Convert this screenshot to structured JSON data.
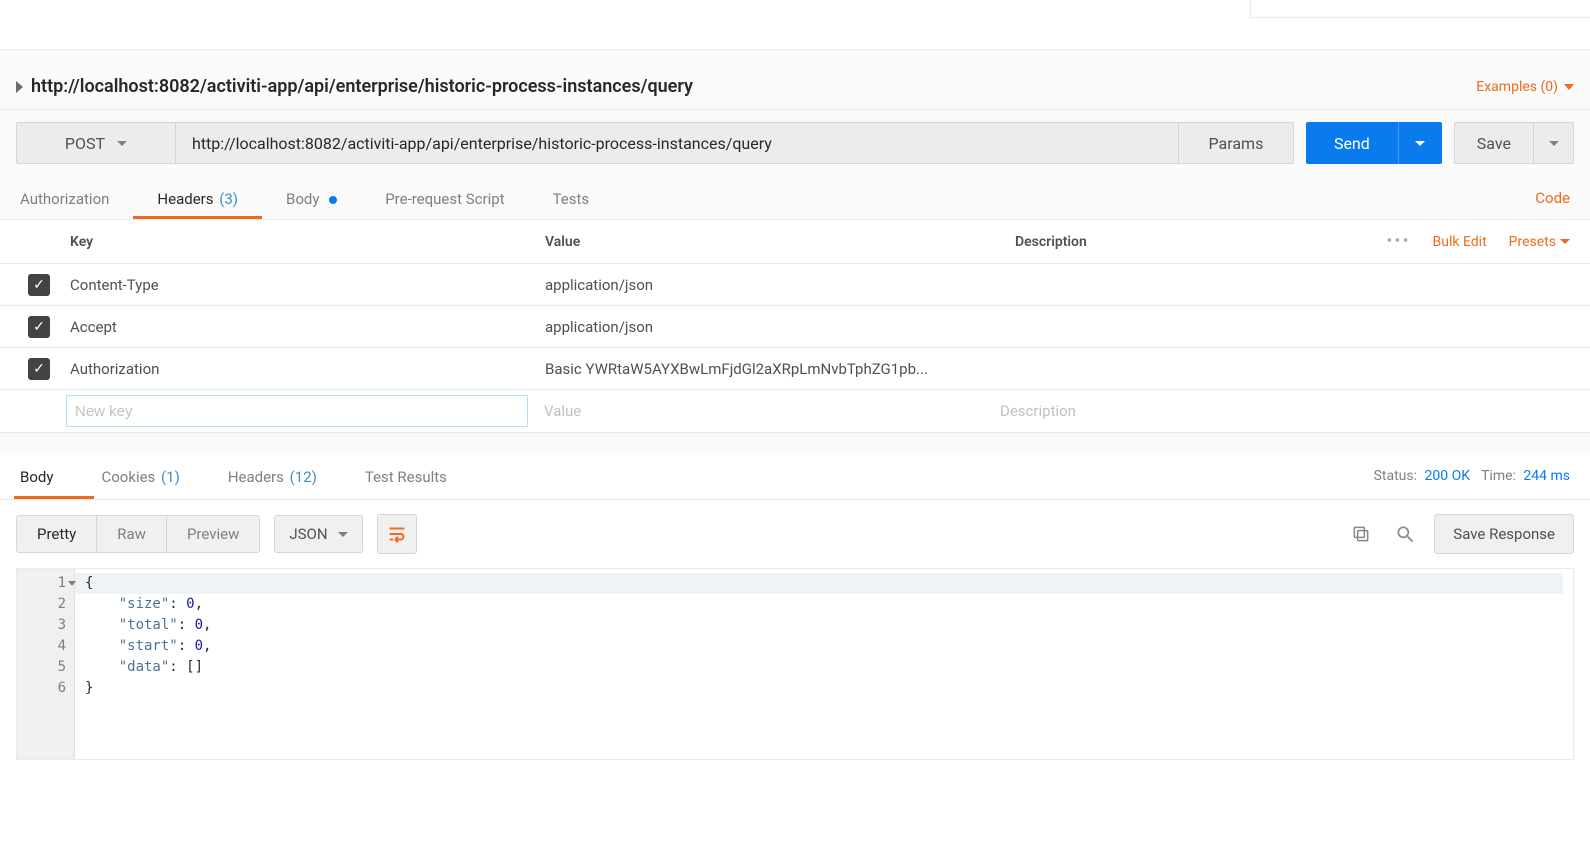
{
  "title": "http://localhost:8082/activiti-app/api/enterprise/historic-process-instances/query",
  "examples": {
    "label": "Examples (0)"
  },
  "request": {
    "method": "POST",
    "url": "http://localhost:8082/activiti-app/api/enterprise/historic-process-instances/query",
    "params_btn": "Params",
    "send_btn": "Send",
    "save_btn": "Save"
  },
  "req_tabs": {
    "authorization": "Authorization",
    "headers": "Headers",
    "headers_count": "(3)",
    "body": "Body",
    "prerequest": "Pre-request Script",
    "tests": "Tests",
    "code": "Code"
  },
  "headers_table": {
    "col_key": "Key",
    "col_value": "Value",
    "col_desc": "Description",
    "bulk_edit": "Bulk Edit",
    "presets": "Presets",
    "rows": [
      {
        "key": "Content-Type",
        "value": "application/json"
      },
      {
        "key": "Accept",
        "value": "application/json"
      },
      {
        "key": "Authorization",
        "value": "Basic YWRtaW5AYXBwLmFjdGl2aXRpLmNvbTphZG1pb..."
      }
    ],
    "new_key_placeholder": "New key",
    "new_value_placeholder": "Value",
    "new_desc_placeholder": "Description"
  },
  "resp_tabs": {
    "body": "Body",
    "cookies": "Cookies",
    "cookies_count": "(1)",
    "headers": "Headers",
    "headers_count": "(12)",
    "test_results": "Test Results"
  },
  "resp_status": {
    "label": "Status:",
    "value": "200 OK"
  },
  "resp_time": {
    "label": "Time:",
    "value": "244 ms"
  },
  "resp_toolbar": {
    "pretty": "Pretty",
    "raw": "Raw",
    "preview": "Preview",
    "lang": "JSON",
    "save_response": "Save Response"
  },
  "code_lines": [
    {
      "n": "1",
      "raw": "{",
      "tokens": [
        {
          "t": "{",
          "c": "json-bracket"
        }
      ]
    },
    {
      "n": "2",
      "raw": "    \"size\": 0,",
      "tokens": [
        {
          "t": "    "
        },
        {
          "t": "\"size\"",
          "c": "json-key"
        },
        {
          "t": ": ",
          "c": "json-punct"
        },
        {
          "t": "0",
          "c": "json-num"
        },
        {
          "t": ",",
          "c": "json-punct"
        }
      ]
    },
    {
      "n": "3",
      "raw": "    \"total\": 0,",
      "tokens": [
        {
          "t": "    "
        },
        {
          "t": "\"total\"",
          "c": "json-key"
        },
        {
          "t": ": ",
          "c": "json-punct"
        },
        {
          "t": "0",
          "c": "json-num"
        },
        {
          "t": ",",
          "c": "json-punct"
        }
      ]
    },
    {
      "n": "4",
      "raw": "    \"start\": 0,",
      "tokens": [
        {
          "t": "    "
        },
        {
          "t": "\"start\"",
          "c": "json-key"
        },
        {
          "t": ": ",
          "c": "json-punct"
        },
        {
          "t": "0",
          "c": "json-num"
        },
        {
          "t": ",",
          "c": "json-punct"
        }
      ]
    },
    {
      "n": "5",
      "raw": "    \"data\": []",
      "tokens": [
        {
          "t": "    "
        },
        {
          "t": "\"data\"",
          "c": "json-key"
        },
        {
          "t": ": ",
          "c": "json-punct"
        },
        {
          "t": "[]",
          "c": "json-bracket"
        }
      ]
    },
    {
      "n": "6",
      "raw": "}",
      "tokens": [
        {
          "t": "}",
          "c": "json-bracket"
        }
      ]
    }
  ]
}
